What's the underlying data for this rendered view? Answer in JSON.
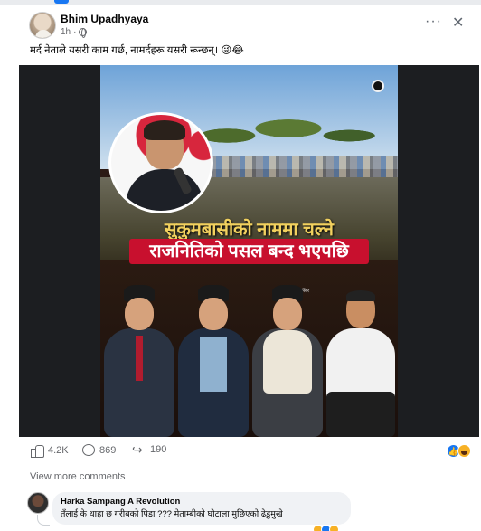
{
  "post": {
    "author": "Bhim Upadhyaya",
    "time": "1h",
    "dot": "·",
    "more_label": "···",
    "close_label": "✕",
    "caption": "मर्द नेताले यसरी काम गर्छ, नामर्दहरू यसरी रून्छन्। 😜😂"
  },
  "image": {
    "headline_line1": "सुकुमबासीको नाममा चल्ने",
    "headline_line2": "राजनितिको पसल बन्द भएपछि",
    "credit": "तस्बिर"
  },
  "stats": {
    "likes": "4.2K",
    "comments": "869",
    "shares": "190"
  },
  "comments": {
    "view_more_label": "View more comments",
    "items": [
      {
        "author": "Harka Sampang A Revolution",
        "text": "तँलाई के थाहा छ गरीबको पिडा ??? मेताम्बीको घोटाला मुछिएको ढेडुमुखे"
      }
    ]
  },
  "colors": {
    "accent": "#1877f2",
    "secondary_text": "#65676b",
    "headline_red": "#c8102e",
    "headline_yellow": "#f2d15e"
  },
  "icons": [
    "globe-icon",
    "more-icon",
    "close-icon",
    "like-icon",
    "comment-icon",
    "share-icon",
    "like-reaction-icon",
    "haha-reaction-icon"
  ]
}
